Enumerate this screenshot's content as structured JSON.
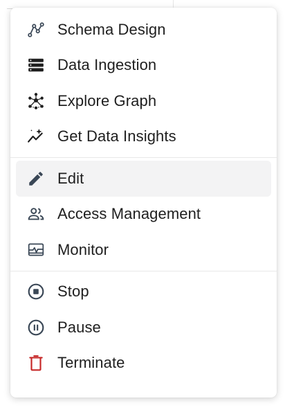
{
  "menu": {
    "groups": [
      {
        "items": [
          {
            "label": "Schema Design",
            "icon": "schema-icon"
          },
          {
            "label": "Data Ingestion",
            "icon": "database-icon"
          },
          {
            "label": "Explore Graph",
            "icon": "graph-icon"
          },
          {
            "label": "Get Data Insights",
            "icon": "insights-icon"
          }
        ]
      },
      {
        "items": [
          {
            "label": "Edit",
            "icon": "pencil-icon",
            "active": true
          },
          {
            "label": "Access Management",
            "icon": "people-icon"
          },
          {
            "label": "Monitor",
            "icon": "monitor-icon"
          }
        ]
      },
      {
        "items": [
          {
            "label": "Stop",
            "icon": "stop-circle-icon"
          },
          {
            "label": "Pause",
            "icon": "pause-circle-icon"
          },
          {
            "label": "Terminate",
            "icon": "trash-icon",
            "color": "#c62828"
          }
        ]
      }
    ],
    "icon_color": "#3a4756",
    "active_bg": "#f3f3f4"
  }
}
